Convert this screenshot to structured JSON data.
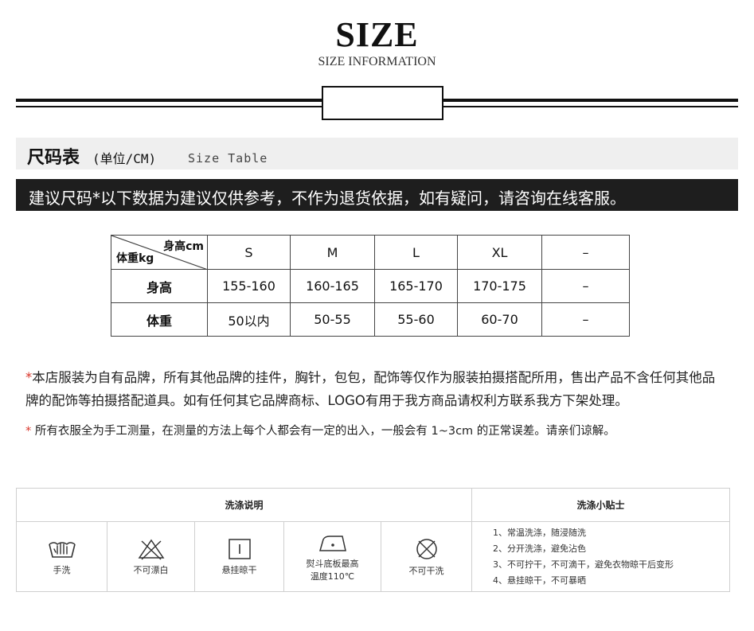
{
  "header": {
    "title": "SIZE",
    "subtitle": "SIZE INFORMATION"
  },
  "section": {
    "title": "尺码表",
    "unit": "(单位/CM)",
    "en": "Size Table"
  },
  "notice": "建议尺码*以下数据为建议仅供参考，不作为退货依据，如有疑问，请咨询在线客服。",
  "size_table": {
    "corner_top": "身高cm",
    "corner_bottom": "体重kg",
    "columns": [
      "S",
      "M",
      "L",
      "XL",
      "–"
    ],
    "rows": [
      {
        "label": "身高",
        "values": [
          "155-160",
          "160-165",
          "165-170",
          "170-175",
          "–"
        ]
      },
      {
        "label": "体重",
        "values": [
          "50以内",
          "50-55",
          "55-60",
          "60-70",
          "–"
        ]
      }
    ]
  },
  "notes": {
    "star": "*",
    "note1": "本店服装为自有品牌，所有其他品牌的挂件，胸针，包包，配饰等仅作为服装拍摄搭配所用，售出产品不含任何其他品牌的配饰等拍摄搭配道具。如有任何其它品牌商标、LOGO有用于我方商品请权利方联系我方下架处理。",
    "note2": "所有衣服全为手工测量，在测量的方法上每个人都会有一定的出入，一般会有 1~3cm 的正常误差。请亲们谅解。"
  },
  "care": {
    "heading_left": "洗涤说明",
    "heading_right": "洗涤小贴士",
    "items": [
      {
        "icon": "hand-wash-icon",
        "label": "手洗"
      },
      {
        "icon": "no-bleach-icon",
        "label": "不可漂白"
      },
      {
        "icon": "hang-dry-icon",
        "label": "悬挂晾干"
      },
      {
        "icon": "iron-icon",
        "label": "熨斗底板最高",
        "label2": "温度110℃"
      },
      {
        "icon": "no-dry-clean-icon",
        "label": "不可干洗"
      }
    ],
    "tips": [
      "1、常温洗涤，随浸随洗",
      "2、分开洗涤，避免沾色",
      "3、不可拧干，不可滴干，避免衣物晾干后变形",
      "4、悬挂晾干，不可暴晒"
    ]
  }
}
